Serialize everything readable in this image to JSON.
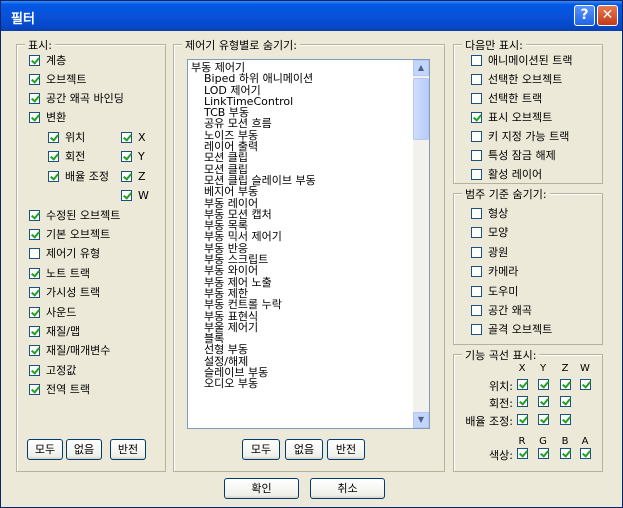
{
  "window": {
    "title": "필터",
    "help": "?",
    "close": "✕"
  },
  "show": {
    "legend": "표시:",
    "items": [
      {
        "label": "계층",
        "checked": true
      },
      {
        "label": "오브젝트",
        "checked": true
      },
      {
        "label": "공간 왜곡 바인딩",
        "checked": true
      },
      {
        "label": "변환",
        "checked": true
      },
      {
        "label": "수정된 오브젝트",
        "checked": true
      },
      {
        "label": "기본 오브젝트",
        "checked": true
      },
      {
        "label": "제어기 유형",
        "checked": false
      },
      {
        "label": "노트 트랙",
        "checked": true
      },
      {
        "label": "가시성 트랙",
        "checked": true
      },
      {
        "label": "사운드",
        "checked": true
      },
      {
        "label": "재질/맵",
        "checked": true
      },
      {
        "label": "재질/매개변수",
        "checked": true
      },
      {
        "label": "고정값",
        "checked": true
      },
      {
        "label": "전역 트랙",
        "checked": true
      }
    ],
    "transform": [
      {
        "label": "위치",
        "checked": true
      },
      {
        "label": "회전",
        "checked": true
      },
      {
        "label": "배율 조정",
        "checked": true
      }
    ],
    "axes": [
      {
        "label": "X",
        "checked": true
      },
      {
        "label": "Y",
        "checked": true
      },
      {
        "label": "Z",
        "checked": true
      },
      {
        "label": "W",
        "checked": true
      }
    ],
    "buttons": [
      "모두",
      "없음",
      "반전"
    ]
  },
  "controllers": {
    "legend": "제어기 유형별로 숨기기:",
    "items": [
      "부동 제어기",
      "Biped 하위 애니메이션",
      "LOD 제어기",
      "LinkTimeControl",
      "TCB 부동",
      "공유 모션 흐름",
      "노이즈 부동",
      "레이어 출력",
      "모션 클립",
      "모션 클립",
      "모션 클립 슬레이브 부동",
      "베지어 부동",
      "부동 레이어",
      "부동 모션 캡처",
      "부동 목록",
      "부동 믹서 제어기",
      "부동 반응",
      "부동 스크립트",
      "부동 와이어",
      "부동 제어 노출",
      "부동 제한",
      "부동 컨트롤 누락",
      "부동 표현식",
      "부울 제어기",
      "블록",
      "선형 부동",
      "설정/해제",
      "슬레이브 부동",
      "오디오 부동"
    ],
    "buttons": [
      "모두",
      "없음",
      "반전"
    ]
  },
  "show_only": {
    "legend": "다음만 표시:",
    "items": [
      {
        "label": "애니메이션된 트랙",
        "checked": false
      },
      {
        "label": "선택한 오브젝트",
        "checked": false
      },
      {
        "label": "선택한 트랙",
        "checked": false
      },
      {
        "label": "표시 오브젝트",
        "checked": true
      },
      {
        "label": "키 지정 가능 트랙",
        "checked": false
      },
      {
        "label": "특성 잠금 해제",
        "checked": false
      },
      {
        "label": "활성 레이어",
        "checked": false
      }
    ]
  },
  "hide_category": {
    "legend": "범주 기준 숨기기:",
    "items": [
      {
        "label": "형상",
        "checked": false
      },
      {
        "label": "모양",
        "checked": false
      },
      {
        "label": "광원",
        "checked": false
      },
      {
        "label": "카메라",
        "checked": false
      },
      {
        "label": "도우미",
        "checked": false
      },
      {
        "label": "공간 왜곡",
        "checked": false
      },
      {
        "label": "골격 오브젝트",
        "checked": false
      }
    ]
  },
  "curves": {
    "legend": "기능 곡선 표시:",
    "cols1": [
      "X",
      "Y",
      "Z",
      "W"
    ],
    "cols2": [
      "R",
      "G",
      "B",
      "A"
    ],
    "rows": [
      {
        "label": "위치:",
        "checks": [
          true,
          true,
          true,
          true
        ]
      },
      {
        "label": "회전:",
        "checks": [
          true,
          true,
          true,
          null
        ]
      },
      {
        "label": "배율 조정:",
        "checks": [
          true,
          true,
          true,
          null
        ]
      },
      {
        "label": "색상:",
        "checks": [
          true,
          true,
          true,
          true
        ]
      }
    ]
  },
  "footer": {
    "ok": "확인",
    "cancel": "취소"
  }
}
